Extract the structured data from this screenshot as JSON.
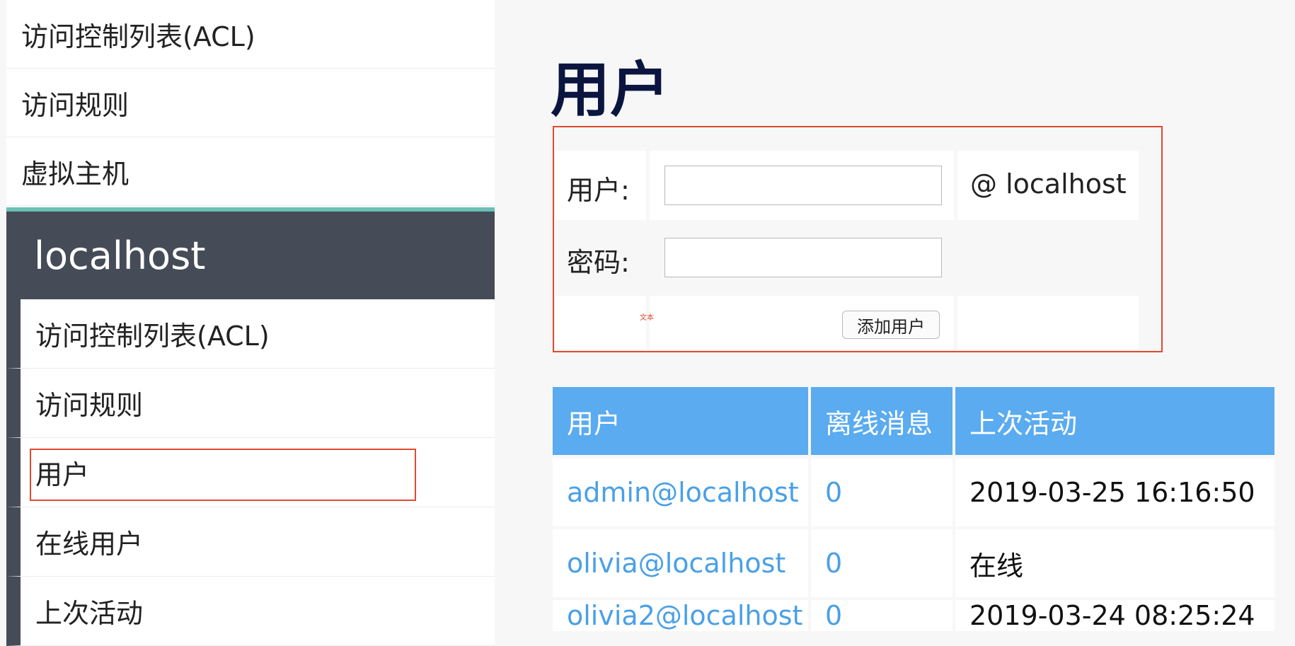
{
  "sidebar": {
    "top_items": [
      {
        "label": "访问控制列表(ACL)"
      },
      {
        "label": "访问规则"
      },
      {
        "label": "虚拟主机"
      }
    ],
    "host": "localhost",
    "sub_items": [
      {
        "label": "访问控制列表(ACL)"
      },
      {
        "label": "访问规则"
      },
      {
        "label": "用户"
      },
      {
        "label": "在线用户"
      },
      {
        "label": "上次活动"
      }
    ]
  },
  "main": {
    "title": "用户",
    "form": {
      "user_label": "用户:",
      "user_value": "",
      "host_suffix": "@ localhost",
      "password_label": "密码:",
      "password_value": "",
      "note": "文本",
      "add_button": "添加用户"
    },
    "table": {
      "headers": [
        "用户",
        "离线消息",
        "上次活动"
      ],
      "rows": [
        {
          "user": "admin@localhost",
          "offline": "0",
          "last": "2019-03-25 16:16:50"
        },
        {
          "user": "olivia@localhost",
          "offline": "0",
          "last": "在线"
        },
        {
          "user": "olivia2@localhost",
          "offline": "0",
          "last": "2019-03-24 08:25:24"
        }
      ]
    }
  },
  "colors": {
    "accent": "#5aabf0",
    "host_bar": "#454c57",
    "host_bar_top": "#6bbfb4",
    "highlight": "#e04a2f",
    "title": "#0a1540",
    "link": "#4aa0e6"
  }
}
